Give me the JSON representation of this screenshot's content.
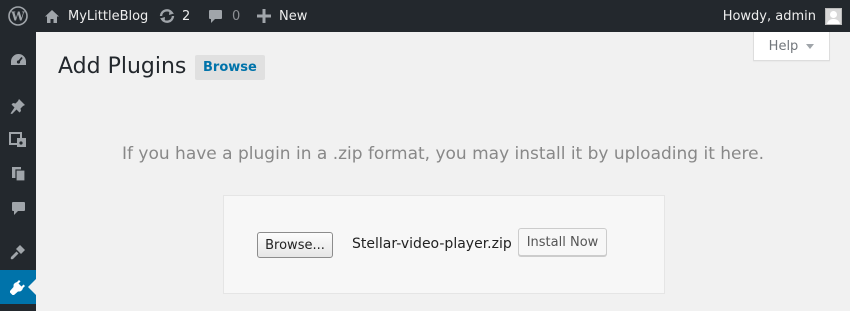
{
  "admin_bar": {
    "site_name": "MyLittleBlog",
    "updates_count": "2",
    "comments_count": "0",
    "new_label": "New",
    "greeting": "Howdy, admin"
  },
  "help_tab": {
    "label": "Help"
  },
  "page": {
    "title": "Add Plugins",
    "title_action": "Browse"
  },
  "upload": {
    "help_text": "If you have a plugin in a .zip format, you may install it by uploading it here.",
    "browse_label": "Browse...",
    "file_name": "Stellar-video-player.zip",
    "install_label": "Install Now"
  },
  "side_menu": {
    "items": [
      "dashboard-icon",
      "pin-icon",
      "media-icon",
      "pages-icon",
      "comments-icon",
      "appearance-icon",
      "plugins-icon"
    ],
    "current": "plugins-icon"
  },
  "colors": {
    "admin_bar_bg": "#23282d",
    "accent": "#0073aa",
    "page_bg": "#f1f1f1"
  }
}
